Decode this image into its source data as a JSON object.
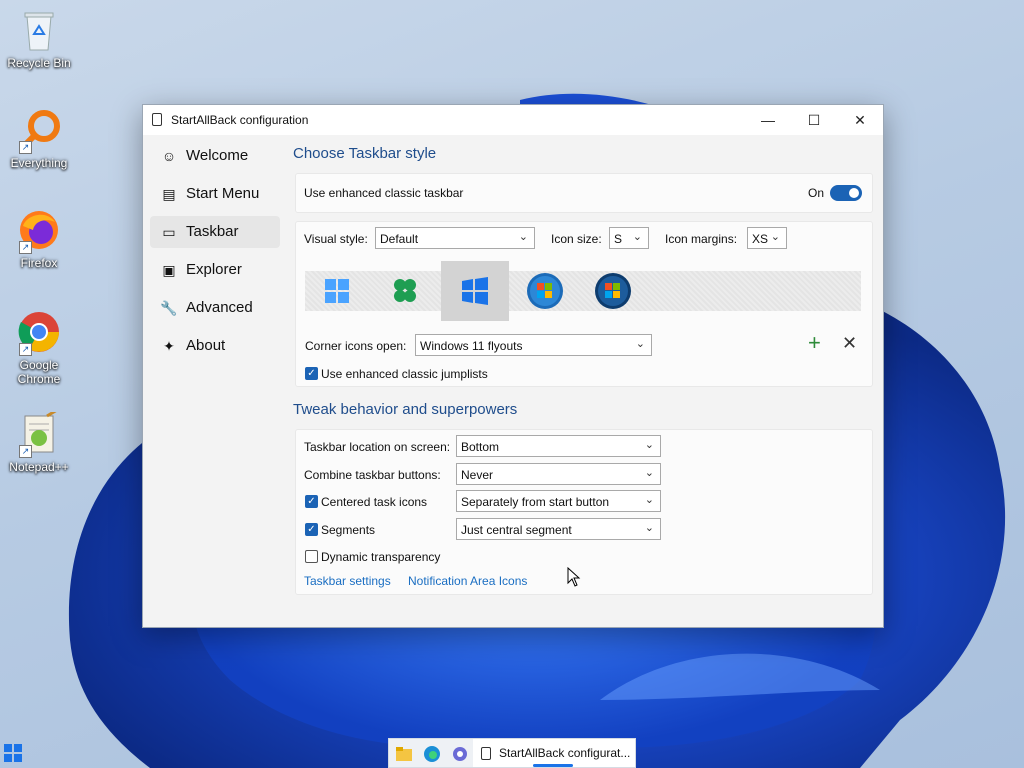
{
  "desktop": {
    "icons": [
      {
        "label": "Recycle Bin",
        "icon": "recycle-bin-icon"
      },
      {
        "label": "Everything",
        "icon": "everything-search-icon"
      },
      {
        "label": "Firefox",
        "icon": "firefox-icon"
      },
      {
        "label": "Google Chrome",
        "icon": "chrome-icon"
      },
      {
        "label": "Notepad++",
        "icon": "notepadpp-icon"
      }
    ]
  },
  "window": {
    "title": "StartAllBack configuration",
    "controls": {
      "minimize": "—",
      "maximize": "☐",
      "close": "✕"
    }
  },
  "sidebar": {
    "items": [
      {
        "label": "Welcome",
        "icon": "☺"
      },
      {
        "label": "Start Menu",
        "icon": "▤"
      },
      {
        "label": "Taskbar",
        "icon": "▭"
      },
      {
        "label": "Explorer",
        "icon": "▣"
      },
      {
        "label": "Advanced",
        "icon": "🔧"
      },
      {
        "label": "About",
        "icon": "✦"
      }
    ],
    "selected": "Taskbar"
  },
  "taskbar_style": {
    "heading": "Choose Taskbar style",
    "enhanced_label": "Use enhanced classic taskbar",
    "enhanced_state": "On",
    "visual_style_label": "Visual style:",
    "visual_style_value": "Default",
    "icon_size_label": "Icon size:",
    "icon_size_value": "S",
    "icon_margins_label": "Icon margins:",
    "icon_margins_value": "XS",
    "styles": [
      "windows-11-icon",
      "clover-icon",
      "windows-10-icon",
      "windows-7-orb-icon",
      "windows-vista-orb-icon"
    ],
    "corner_label": "Corner icons open:",
    "corner_value": "Windows 11 flyouts",
    "add_symbol": "+",
    "remove_symbol": "✕",
    "jumplists_label": "Use enhanced classic jumplists"
  },
  "tweak": {
    "heading": "Tweak behavior and superpowers",
    "location_label": "Taskbar location on screen:",
    "location_value": "Bottom",
    "combine_label": "Combine taskbar buttons:",
    "combine_value": "Never",
    "centered_label": "Centered task icons",
    "centered_value": "Separately from start button",
    "segments_label": "Segments",
    "segments_value": "Just central segment",
    "transparency_label": "Dynamic transparency",
    "link_taskbar": "Taskbar settings",
    "link_notification": "Notification Area Icons"
  },
  "taskbar": {
    "active_app": "StartAllBack configurat..."
  }
}
